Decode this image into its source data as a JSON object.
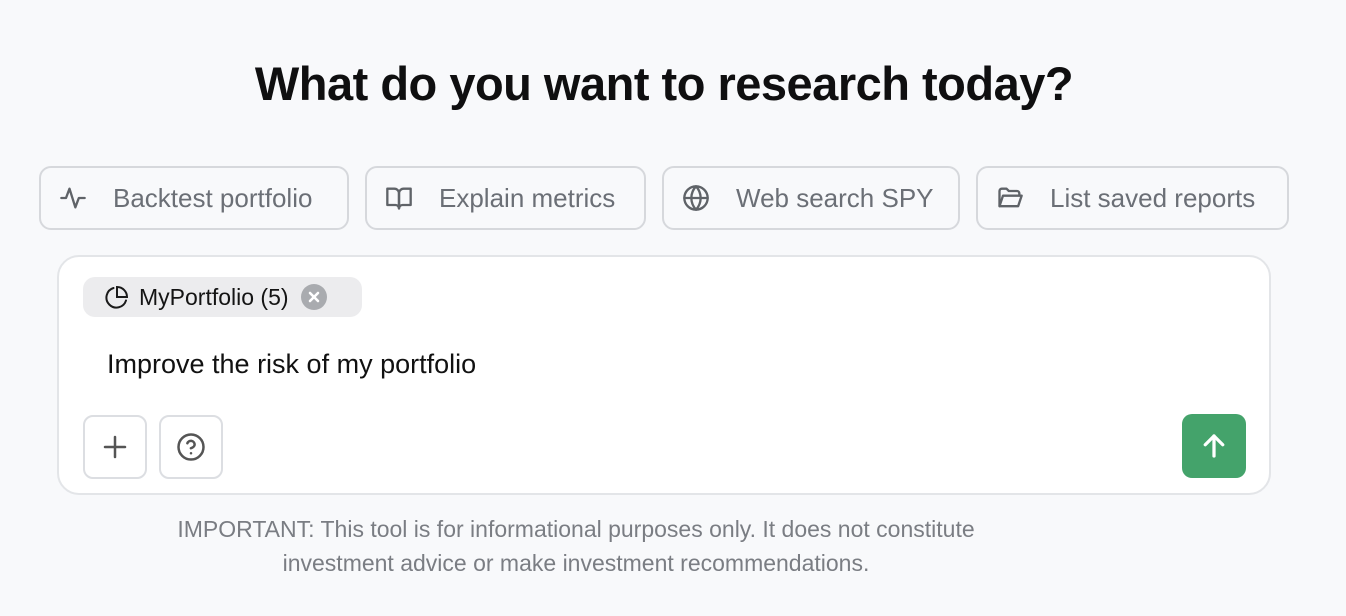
{
  "heading": "What do you want to research today?",
  "suggestions": [
    {
      "label": "Backtest portfolio",
      "icon": "activity-icon"
    },
    {
      "label": "Explain metrics",
      "icon": "book-icon"
    },
    {
      "label": "Web search SPY",
      "icon": "globe-icon"
    },
    {
      "label": "List saved reports",
      "icon": "folder-icon"
    }
  ],
  "composer": {
    "context": {
      "label": "MyPortfolio (5)",
      "icon": "pie-chart-icon"
    },
    "prompt": "Improve the risk of my portfolio",
    "send_color": "#44a36b"
  },
  "disclaimer": "IMPORTANT: This tool is for informational purposes only. It does not constitute investment advice or make investment recommendations."
}
